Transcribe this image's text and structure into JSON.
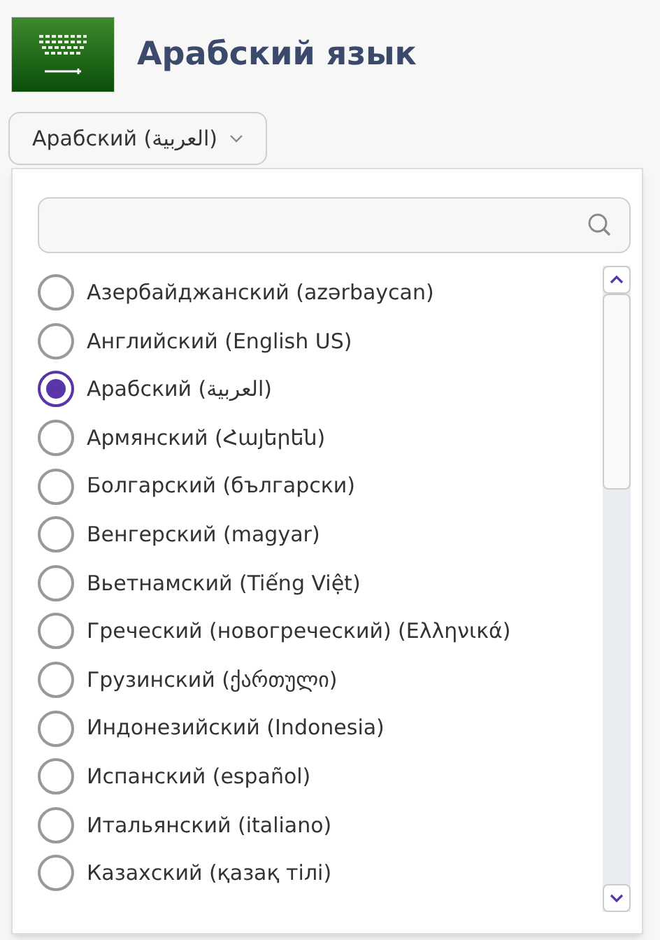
{
  "header": {
    "title": "Арабский язык"
  },
  "select": {
    "value": "Арабский (العربية)"
  },
  "dropdown": {
    "options": [
      {
        "label": "Азербайджанский (azərbaycan)",
        "selected": false
      },
      {
        "label": "Английский (English US)",
        "selected": false
      },
      {
        "label": "Арабский (العربية)",
        "selected": true
      },
      {
        "label": "Армянский (Հայերեն)",
        "selected": false
      },
      {
        "label": "Болгарский (български)",
        "selected": false
      },
      {
        "label": "Венгерский (magyar)",
        "selected": false
      },
      {
        "label": "Вьетнамский (Tiếng Việt)",
        "selected": false
      },
      {
        "label": "Греческий (новогреческий) (Ελληνικά)",
        "selected": false
      },
      {
        "label": "Грузинский (ქართული)",
        "selected": false
      },
      {
        "label": "Индонезийский (Indonesia)",
        "selected": false
      },
      {
        "label": "Испанский (español)",
        "selected": false
      },
      {
        "label": "Итальянский (italiano)",
        "selected": false
      },
      {
        "label": "Казахский (қазақ тілі)",
        "selected": false
      }
    ]
  }
}
